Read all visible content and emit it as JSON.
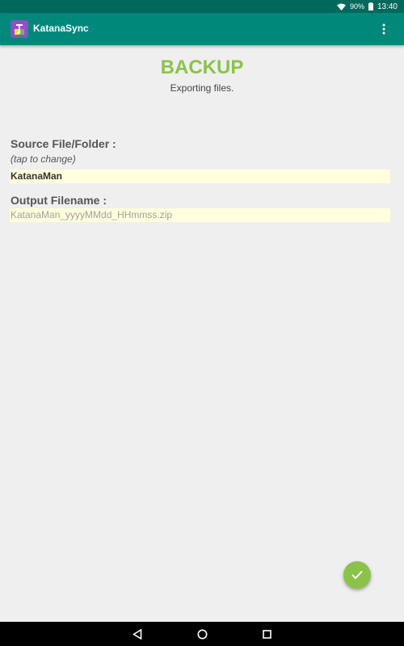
{
  "status_bar": {
    "battery": "90%",
    "time": "13:40",
    "icons": [
      "wifi-icon",
      "battery-icon"
    ]
  },
  "app_bar": {
    "title": "KatanaSync",
    "icons": [
      "app-logo-icon",
      "more-vert-icon"
    ]
  },
  "page": {
    "title": "BACKUP",
    "subtitle": "Exporting files."
  },
  "source": {
    "label": "Source File/Folder :",
    "hint": "(tap to change)",
    "value": "KatanaMan"
  },
  "output": {
    "label": "Output Filename :",
    "placeholder": "KatanaMan_yyyyMMdd_HHmmss.zip"
  },
  "fab": {
    "icon": "check-icon"
  },
  "nav_bar": {
    "icons": [
      "back-icon",
      "home-icon",
      "recents-icon"
    ]
  },
  "colors": {
    "status_bar": "#00695c",
    "app_bar": "#00897b",
    "accent": "#8bc34a",
    "field_bg": "#ffffdd",
    "background": "#efefef"
  }
}
